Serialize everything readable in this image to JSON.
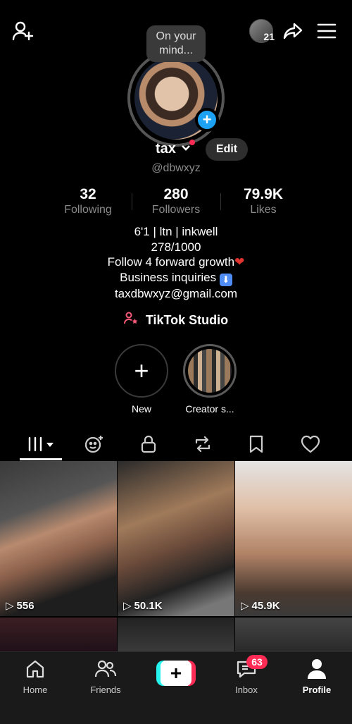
{
  "top_bar": {
    "notification_count": "21"
  },
  "mind_bubble": "On your mind...",
  "profile": {
    "username": "tax",
    "edit_label": "Edit",
    "handle": "@dbwxyz"
  },
  "stats": [
    {
      "value": "32",
      "label": "Following"
    },
    {
      "value": "280",
      "label": "Followers"
    },
    {
      "value": "79.9K",
      "label": "Likes"
    }
  ],
  "bio": {
    "line1": "6'1 | ltn | inkwell",
    "line2": "278/1000",
    "line3": "Follow 4 forward growth",
    "line4": "Business inquiries",
    "line5": "taxdbwxyz@gmail.com"
  },
  "studio_link": "TikTok Studio",
  "highlights": [
    {
      "label": "New"
    },
    {
      "label": "Creator s..."
    }
  ],
  "tabs": [
    {
      "icon": "videos-grid-icon",
      "active": true
    },
    {
      "icon": "reposts-face-icon"
    },
    {
      "icon": "lock-icon"
    },
    {
      "icon": "repost-icon"
    },
    {
      "icon": "bookmark-icon"
    },
    {
      "icon": "heart-icon"
    }
  ],
  "videos": [
    {
      "views": "556"
    },
    {
      "views": "50.1K"
    },
    {
      "views": "45.9K"
    },
    {
      "views": ""
    },
    {
      "views": ""
    },
    {
      "views": ""
    }
  ],
  "bottom_nav": {
    "home": "Home",
    "friends": "Friends",
    "inbox": "Inbox",
    "inbox_badge": "63",
    "profile": "Profile"
  },
  "colors": {
    "accent_red": "#fe2c55",
    "accent_cyan": "#25f4ee",
    "plus_blue": "#1da1f2"
  }
}
